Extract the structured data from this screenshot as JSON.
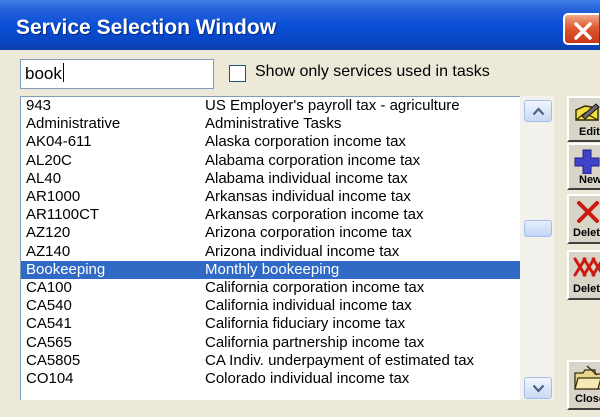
{
  "window": {
    "title": "Service Selection Window"
  },
  "search": {
    "value": "book"
  },
  "filter": {
    "label": "Show only services used in tasks",
    "checked": false
  },
  "services": [
    {
      "code": "943",
      "desc": "US Employer's payroll tax - agriculture"
    },
    {
      "code": "Administrative",
      "desc": "Administrative Tasks"
    },
    {
      "code": "AK04-611",
      "desc": "Alaska corporation income tax"
    },
    {
      "code": "AL20C",
      "desc": "Alabama corporation income tax"
    },
    {
      "code": "AL40",
      "desc": "Alabama individual income tax"
    },
    {
      "code": "AR1000",
      "desc": "Arkansas individual income tax"
    },
    {
      "code": "AR1100CT",
      "desc": "Arkansas corporation income tax"
    },
    {
      "code": "AZ120",
      "desc": "Arizona corporation income tax"
    },
    {
      "code": "AZ140",
      "desc": "Arizona individual income tax"
    },
    {
      "code": "Bookeeping",
      "desc": "Monthly bookeeping",
      "selected": true
    },
    {
      "code": "CA100",
      "desc": "California corporation income tax"
    },
    {
      "code": "CA540",
      "desc": "California individual income tax"
    },
    {
      "code": "CA541",
      "desc": "California fiduciary income tax"
    },
    {
      "code": "CA565",
      "desc": "California partnership income tax"
    },
    {
      "code": "CA5805",
      "desc": "CA Indiv. underpayment of estimated tax"
    },
    {
      "code": "CO104",
      "desc": "Colorado individual income tax"
    }
  ],
  "buttons": {
    "edit": "Edit",
    "new": "New",
    "delete": "Delete",
    "delete_all": "Delete",
    "close": "Close"
  },
  "colors": {
    "title_bar": "#0a4fd6",
    "selection": "#316ac5",
    "dialog_bg": "#ECE9D8"
  }
}
